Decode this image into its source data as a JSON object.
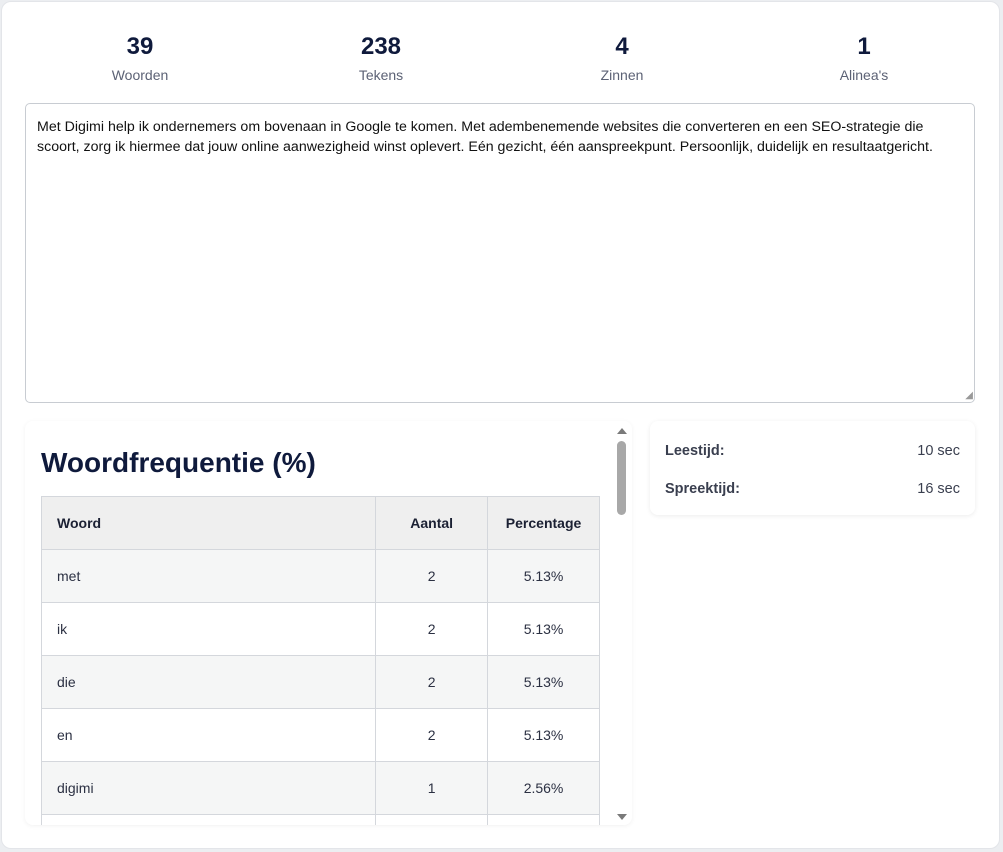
{
  "stats": [
    {
      "value": "39",
      "label": "Woorden"
    },
    {
      "value": "238",
      "label": "Tekens"
    },
    {
      "value": "4",
      "label": "Zinnen"
    },
    {
      "value": "1",
      "label": "Alinea's"
    }
  ],
  "editor": {
    "text": "Met Digimi help ik ondernemers om bovenaan in Google te komen. Met adembenemende websites die converteren en een SEO-strategie die scoort, zorg ik hiermee dat jouw online aanwezigheid winst oplevert. Eén gezicht, één aanspreekpunt. Persoonlijk, duidelijk en resultaatgericht."
  },
  "frequency": {
    "title": "Woordfrequentie (%)",
    "headers": {
      "word": "Woord",
      "count": "Aantal",
      "percentage": "Percentage"
    },
    "rows": [
      {
        "word": "met",
        "count": "2",
        "percentage": "5.13%"
      },
      {
        "word": "ik",
        "count": "2",
        "percentage": "5.13%"
      },
      {
        "word": "die",
        "count": "2",
        "percentage": "5.13%"
      },
      {
        "word": "en",
        "count": "2",
        "percentage": "5.13%"
      },
      {
        "word": "digimi",
        "count": "1",
        "percentage": "2.56%"
      },
      {
        "word": "",
        "count": "",
        "percentage": ""
      }
    ]
  },
  "times": {
    "reading_label": "Leestijd:",
    "reading_value": "10 sec",
    "speaking_label": "Spreektijd:",
    "speaking_value": "16 sec"
  }
}
